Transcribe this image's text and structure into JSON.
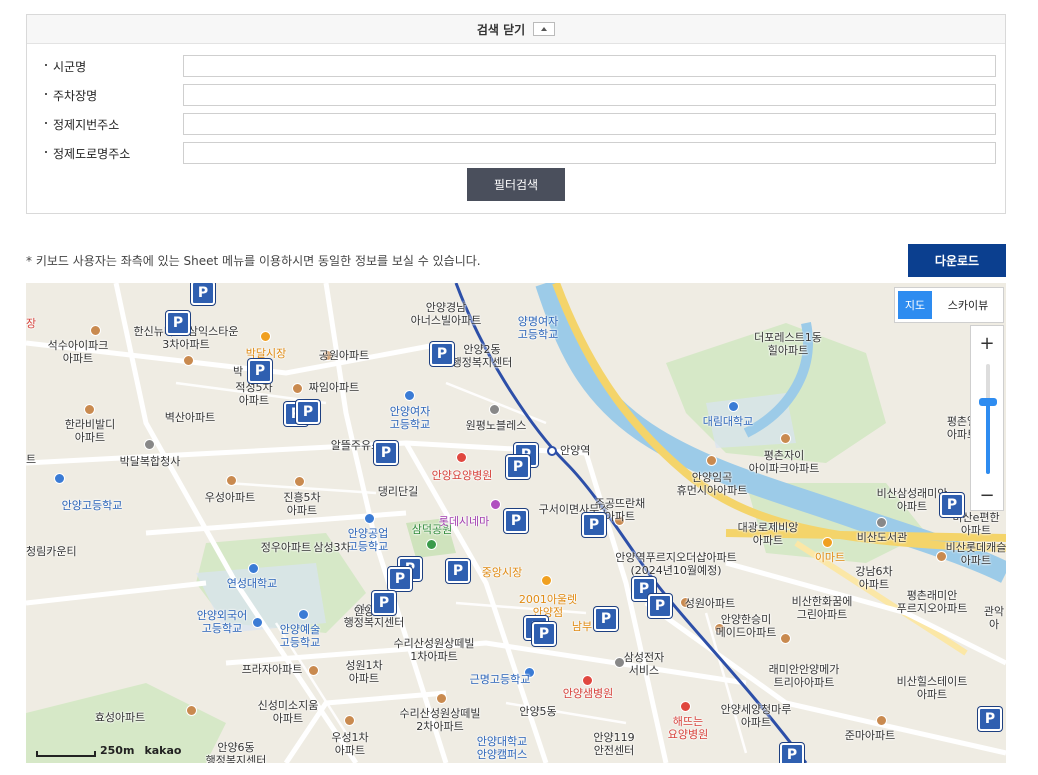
{
  "search": {
    "header_title": "검색 닫기",
    "fields": [
      {
        "label": "시군명",
        "value": ""
      },
      {
        "label": "주차장명",
        "value": ""
      },
      {
        "label": "정제지번주소",
        "value": ""
      },
      {
        "label": "정제도로명주소",
        "value": ""
      }
    ],
    "filter_button": "필터검색"
  },
  "notice": "* 키보드 사용자는 좌측에 있는 Sheet 메뉴를 이용하시면 동일한 정보를 보실 수 있습니다.",
  "download_button": "다운로드",
  "map": {
    "type_tabs": [
      "지도",
      "스카이뷰"
    ],
    "zoom_in": "+",
    "zoom_out": "−",
    "zoom_level_fraction": 0.65,
    "scale_label": "250m",
    "provider": "kakao",
    "parking_glyph": "P",
    "labels": [
      {
        "text": "안양경남\n아너스빌아파트",
        "style": ""
      },
      {
        "text": "양명여자\n고등학교",
        "style": "blue"
      },
      {
        "text": "한신뉴타운/삼익스타운\n3차아파트",
        "style": ""
      },
      {
        "text": "석수아이파크\n아파트",
        "style": ""
      },
      {
        "text": "박달시장",
        "style": "orange"
      },
      {
        "text": "공원아파트",
        "style": ""
      },
      {
        "text": "안양2동\n행정복지센터",
        "style": ""
      },
      {
        "text": "적성5차\n아파트",
        "style": ""
      },
      {
        "text": "짜임아파트",
        "style": ""
      },
      {
        "text": "안양여자\n고등학교",
        "style": "blue"
      },
      {
        "text": "원평노블레스",
        "style": ""
      },
      {
        "text": "한라비발디\n아파트",
        "style": ""
      },
      {
        "text": "벽산아파트",
        "style": ""
      },
      {
        "text": "알뜰주유소",
        "style": ""
      },
      {
        "text": "안양역",
        "style": ""
      },
      {
        "text": "박달복합청사",
        "style": ""
      },
      {
        "text": "안양요양병원",
        "style": "red"
      },
      {
        "text": "댕리단길",
        "style": ""
      },
      {
        "text": "우성아파트",
        "style": ""
      },
      {
        "text": "진흥5차\n아파트",
        "style": ""
      },
      {
        "text": "안양고등학교",
        "style": "blue"
      },
      {
        "text": "삼덕공원",
        "style": "green"
      },
      {
        "text": "롯데시네마",
        "style": "purple"
      },
      {
        "text": "구서이면사무소",
        "style": ""
      },
      {
        "text": "주공뜨란채\n아파트",
        "style": ""
      },
      {
        "text": "안양공업\n고등학교",
        "style": "blue"
      },
      {
        "text": "정우아파트",
        "style": ""
      },
      {
        "text": "삼성3차",
        "style": ""
      },
      {
        "text": "연성대학교",
        "style": "blue"
      },
      {
        "text": "중앙시장",
        "style": "orange"
      },
      {
        "text": "안양역푸르지오더샵아파트\n(2024년10월예정)",
        "style": ""
      },
      {
        "text": "2001아울렛\n안양점",
        "style": "orange"
      },
      {
        "text": "남부",
        "style": "orange"
      },
      {
        "text": "안양외국어\n고등학교",
        "style": "blue"
      },
      {
        "text": "안양예술\n고등학교",
        "style": "blue"
      },
      {
        "text": "안양9동\n행정복지센터",
        "style": ""
      },
      {
        "text": "수리산성원상떼빌\n1차아파트",
        "style": ""
      },
      {
        "text": "성원아파트",
        "style": ""
      },
      {
        "text": "안양한승미\n메이드아파트",
        "style": ""
      },
      {
        "text": "삼성전자\n서비스",
        "style": ""
      },
      {
        "text": "프라자아파트",
        "style": ""
      },
      {
        "text": "성원1차\n아파트",
        "style": ""
      },
      {
        "text": "근명고등학교",
        "style": "blue"
      },
      {
        "text": "안양샘병원",
        "style": "red"
      },
      {
        "text": "신성미소지움\n아파트",
        "style": ""
      },
      {
        "text": "효성아파트",
        "style": ""
      },
      {
        "text": "수리산성원상떼빌\n2차아파트",
        "style": ""
      },
      {
        "text": "안양5동",
        "style": ""
      },
      {
        "text": "해뜨는\n요양병원",
        "style": "red"
      },
      {
        "text": "우성1차\n아파트",
        "style": ""
      },
      {
        "text": "안양6동\n행정복지센터",
        "style": ""
      },
      {
        "text": "안양대학교\n안양캠퍼스",
        "style": "blue"
      },
      {
        "text": "안양119\n안전센터",
        "style": ""
      },
      {
        "text": "안양세양청마루\n아파트",
        "style": ""
      },
      {
        "text": "더포레스트1동\n힐아파트",
        "style": ""
      },
      {
        "text": "대림대학교",
        "style": "blue"
      },
      {
        "text": "평촌자이\n아이파크아파트",
        "style": ""
      },
      {
        "text": "안양임곡\n휴먼시아아파트",
        "style": ""
      },
      {
        "text": "대광로제비앙\n아파트",
        "style": ""
      },
      {
        "text": "비산도서관",
        "style": ""
      },
      {
        "text": "이마트",
        "style": "orange"
      },
      {
        "text": "강남6차\n아파트",
        "style": ""
      },
      {
        "text": "비산한화꿈에\n그린아파트",
        "style": ""
      },
      {
        "text": "평촌래미안\n푸르지오아파트",
        "style": ""
      },
      {
        "text": "비산삼성래미안\n아파트",
        "style": ""
      },
      {
        "text": "비산롯데캐슬\n아파트",
        "style": ""
      },
      {
        "text": "래미안안양메가\n트리아아파트",
        "style": ""
      },
      {
        "text": "비산힐스테이트\n아파트",
        "style": ""
      },
      {
        "text": "준마아파트",
        "style": ""
      },
      {
        "text": "평촌엘\n아파트",
        "style": ""
      },
      {
        "text": "관악\n아",
        "style": ""
      },
      {
        "text": "비산e편한\n아파트",
        "style": ""
      },
      {
        "text": "장",
        "style": "red"
      },
      {
        "text": "트",
        "style": ""
      },
      {
        "text": "박",
        "style": ""
      },
      {
        "text": "청림카운티",
        "style": ""
      },
      {
        "text": "안양",
        "style": ""
      }
    ],
    "colors": {
      "parking": "#2f5fb0",
      "map_type_active": "#2e8cf0",
      "download": "#0b3f8f",
      "filter": "#4a4f5c"
    }
  }
}
